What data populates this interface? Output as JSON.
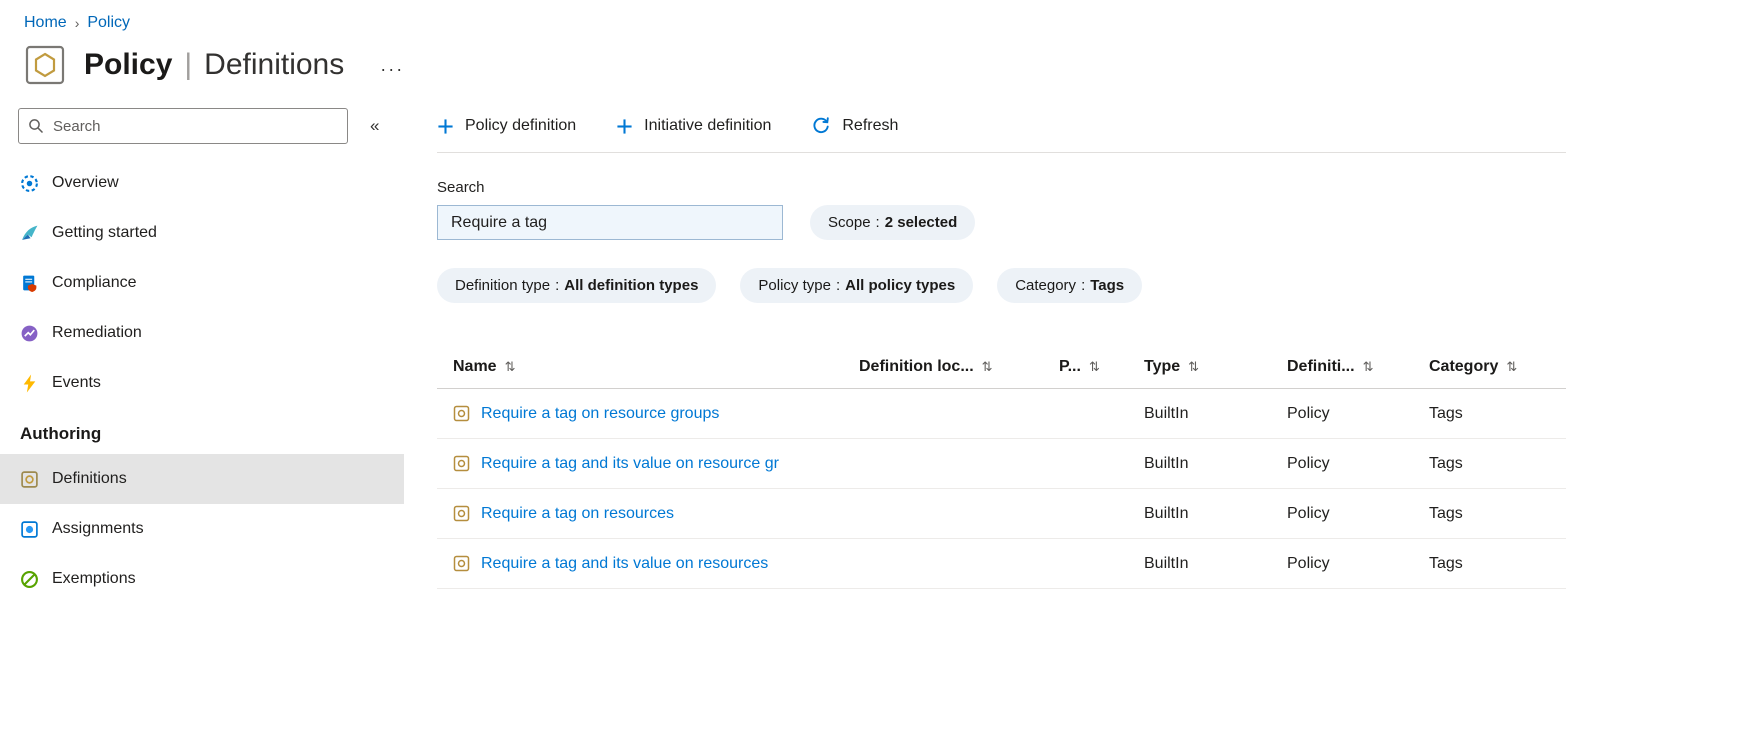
{
  "breadcrumb": {
    "home": "Home",
    "separator": "›",
    "current": "Policy"
  },
  "header": {
    "title": "Policy",
    "divider": "|",
    "subtitle": "Definitions",
    "more": "···",
    "icon": "policy-page-icon"
  },
  "sidebar": {
    "search_placeholder": "Search",
    "collapse": "«",
    "items": [
      {
        "label": "Overview",
        "icon": "overview-icon"
      },
      {
        "label": "Getting started",
        "icon": "getting-started-icon"
      },
      {
        "label": "Compliance",
        "icon": "compliance-icon"
      },
      {
        "label": "Remediation",
        "icon": "remediation-icon"
      },
      {
        "label": "Events",
        "icon": "events-icon"
      }
    ],
    "section": "Authoring",
    "authoring": [
      {
        "label": "Definitions",
        "icon": "definitions-icon",
        "selected": true
      },
      {
        "label": "Assignments",
        "icon": "assignments-icon",
        "selected": false
      },
      {
        "label": "Exemptions",
        "icon": "exemptions-icon",
        "selected": false
      }
    ]
  },
  "toolbar": {
    "items": [
      {
        "label": "Policy definition",
        "icon": "plus-icon"
      },
      {
        "label": "Initiative definition",
        "icon": "plus-icon"
      },
      {
        "label": "Refresh",
        "icon": "refresh-icon"
      }
    ]
  },
  "search": {
    "label": "Search",
    "value": "Require a tag"
  },
  "filters": {
    "separator": ":",
    "pills": [
      {
        "name": "Scope",
        "value": "2 selected"
      },
      {
        "name": "Definition type",
        "value": "All definition types"
      },
      {
        "name": "Policy type",
        "value": "All policy types"
      },
      {
        "name": "Category",
        "value": "Tags"
      }
    ]
  },
  "table": {
    "sort_icon": "⇅",
    "columns": [
      {
        "label": "Name"
      },
      {
        "label": "Definition loc..."
      },
      {
        "label": "P..."
      },
      {
        "label": "Type"
      },
      {
        "label": "Definiti..."
      },
      {
        "label": "Category"
      }
    ],
    "rows": [
      {
        "name": "Require a tag on resource groups",
        "definition_location": "",
        "p": "",
        "type": "BuiltIn",
        "definition_type": "Policy",
        "category": "Tags"
      },
      {
        "name": "Require a tag and its value on resource gr",
        "definition_location": "",
        "p": "",
        "type": "BuiltIn",
        "definition_type": "Policy",
        "category": "Tags"
      },
      {
        "name": "Require a tag on resources",
        "definition_location": "",
        "p": "",
        "type": "BuiltIn",
        "definition_type": "Policy",
        "category": "Tags"
      },
      {
        "name": "Require a tag and its value on resources",
        "definition_location": "",
        "p": "",
        "type": "BuiltIn",
        "definition_type": "Policy",
        "category": "Tags"
      }
    ]
  },
  "colors": {
    "accent": "#0078d4",
    "link": "#0078d4",
    "breadcrumb_link": "#0067b8",
    "pill_bg": "#edf2f7",
    "selected_bg": "#e4e4e4"
  }
}
